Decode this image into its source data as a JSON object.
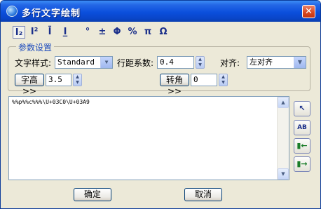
{
  "window": {
    "title": "多行文字绘制",
    "close_symbol": "✕"
  },
  "toolbar": {
    "subscript": "I₂",
    "superscript": "I²",
    "overline": "Ī",
    "underline": "I̲",
    "degree": "°",
    "plus_minus": "±",
    "diameter": "Φ",
    "percent": "%",
    "pi": "π",
    "omega": "Ω"
  },
  "params": {
    "group_label": "参数设置",
    "text_style_label": "文字样式:",
    "text_style_value": "Standard",
    "line_spacing_label": "行距系数:",
    "line_spacing_value": "0.4",
    "align_label": "对齐:",
    "align_value": "左对齐",
    "char_height_button": "字高>>",
    "char_height_value": "3.5",
    "rotation_button": "转角>>",
    "rotation_value": "0"
  },
  "editor": {
    "content": "%%p%%c%%%\\U+03C0\\U+03A9"
  },
  "side_buttons": {
    "pick": "↖",
    "font": "AB",
    "import": "▮←",
    "export": "▮→"
  },
  "footer": {
    "ok": "确定",
    "cancel": "取消"
  }
}
